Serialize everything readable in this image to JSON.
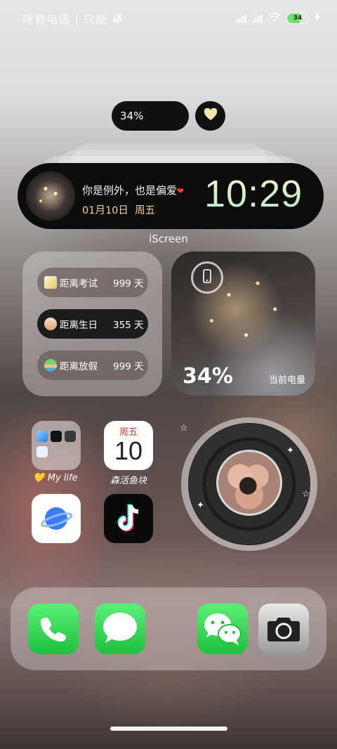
{
  "status_bar": {
    "carrier_text": "呼救电话 | 只能",
    "battery_level": "34",
    "icons": [
      "mute-bell-icon",
      "signal-icon",
      "signal-icon",
      "wifi-icon",
      "battery-icon",
      "charging-bolt-icon"
    ]
  },
  "top_pills": {
    "battery_percent": "34%",
    "heart_icon": "heart-icon"
  },
  "island_widget": {
    "quote": "你是例外，也是偏爱",
    "heart": "❤",
    "date": "01月10日",
    "weekday": "周五",
    "time": "10:29",
    "app_name": "iScreen"
  },
  "countdown_widget": {
    "items": [
      {
        "label": "距离考试",
        "value": "999 天",
        "icon": "memo-icon"
      },
      {
        "label": "距离生日",
        "value": "355 天",
        "icon": "cake-icon"
      },
      {
        "label": "距离放假",
        "value": "999 天",
        "icon": "island-icon"
      }
    ]
  },
  "battery_widget": {
    "percent": "34%",
    "label": "当前电量",
    "icon": "phone-icon"
  },
  "apps": {
    "folder_label": "My life",
    "folder_heart": "💛",
    "calendar_weekday": "周五",
    "calendar_day": "10",
    "calendar_label": "森活鱼块",
    "browser_icon": "planet-icon",
    "tiktok_icon": "tiktok-icon"
  },
  "dock": {
    "apps": [
      "phone-icon",
      "messages-icon",
      "wechat-icon",
      "camera-icon"
    ]
  },
  "colors": {
    "accent_gold": "#f0d08a",
    "green_app": "#1fbf3c",
    "calendar_red": "#e3372f"
  }
}
